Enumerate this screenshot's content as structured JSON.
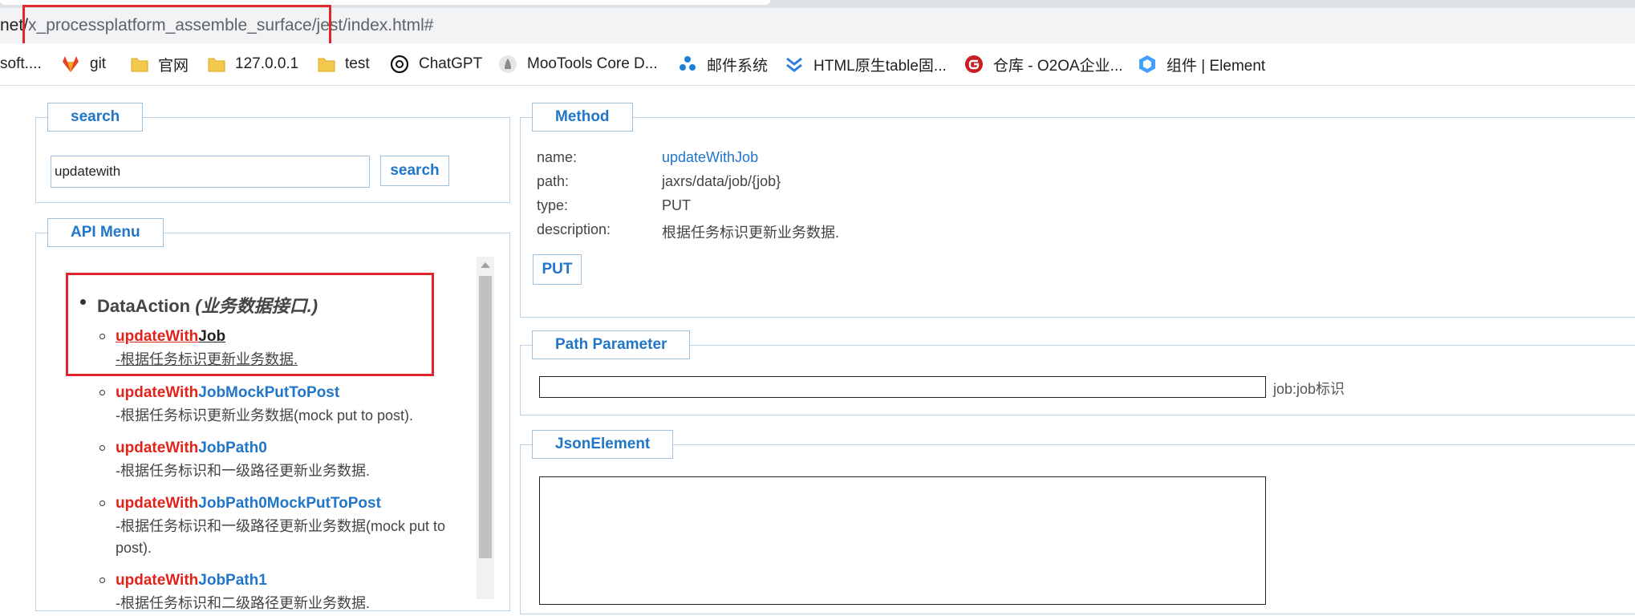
{
  "browser": {
    "url_prefix": "net/",
    "url_highlight": "x_processplatform_assemble_surface/",
    "url_suffix": "jest/index.html#",
    "bookmarks": [
      {
        "label": "soft....",
        "icon": "site-icon"
      },
      {
        "label": "git",
        "icon": "gitlab-icon"
      },
      {
        "label": "官网",
        "icon": "folder-icon"
      },
      {
        "label": "127.0.0.1",
        "icon": "folder-icon"
      },
      {
        "label": "test",
        "icon": "folder-icon"
      },
      {
        "label": "ChatGPT",
        "icon": "chatgpt-icon"
      },
      {
        "label": "MooTools Core D...",
        "icon": "mootools-icon"
      },
      {
        "label": "邮件系统",
        "icon": "mail-system-icon"
      },
      {
        "label": "HTML原生table固...",
        "icon": "chevron-bookmark-icon"
      },
      {
        "label": "仓库 - O2OA企业...",
        "icon": "gitee-icon"
      },
      {
        "label": "组件 | Element",
        "icon": "element-icon"
      }
    ]
  },
  "search": {
    "legend": "search",
    "input_value": "updatewith",
    "button_label": "search"
  },
  "api_menu": {
    "legend": "API Menu",
    "group": {
      "name": "DataAction",
      "desc": "(业务数据接口.)",
      "items": [
        {
          "highlight": "updateWith",
          "rest": "Job",
          "desc": "-根据任务标识更新业务数据."
        },
        {
          "highlight": "updateWith",
          "rest": "JobMockPutToPost",
          "desc": "-根据任务标识更新业务数据(mock put to post)."
        },
        {
          "highlight": "updateWith",
          "rest": "JobPath0",
          "desc": "-根据任务标识和一级路径更新业务数据."
        },
        {
          "highlight": "updateWith",
          "rest": "JobPath0MockPutToPost",
          "desc": "-根据任务标识和一级路径更新业务数据(mock put to post)."
        },
        {
          "highlight": "updateWith",
          "rest": "JobPath1",
          "desc": "-根据任务标识和二级路径更新业务数据."
        }
      ]
    }
  },
  "method": {
    "legend": "Method",
    "name_label": "name:",
    "name_value": "updateWithJob",
    "path_label": "path:",
    "path_value": "jaxrs/data/job/{job}",
    "type_label": "type:",
    "type_value": "PUT",
    "description_label": "description:",
    "description_value": "根据任务标识更新业务数据.",
    "put_button": "PUT"
  },
  "path_parameter": {
    "legend": "Path Parameter",
    "param_label": "job:job标识",
    "value": ""
  },
  "json_element": {
    "legend": "JsonElement",
    "value": ""
  },
  "colors": {
    "accent": "#2176c7",
    "highlight": "#e2231a",
    "annotation_box": "#e0272d",
    "panel_border": "#b8d3ea"
  }
}
